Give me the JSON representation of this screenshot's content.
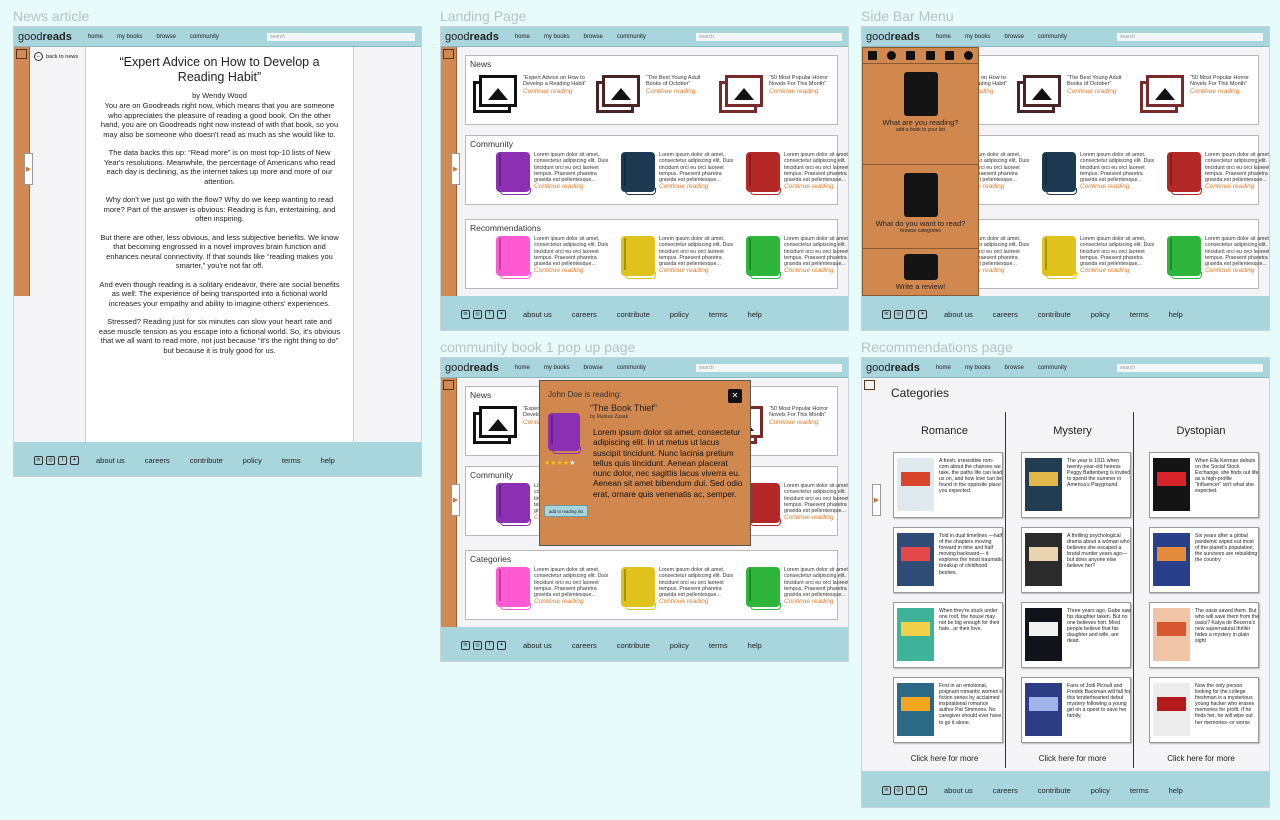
{
  "labels": {
    "news_article": "News article",
    "landing": "Landing Page",
    "sidebar_menu": "Side Bar Menu",
    "popup": "community book 1 pop up page",
    "recommendations": "Recommendations page"
  },
  "nav": {
    "logo_plain": "good",
    "logo_bold": "reads",
    "links": [
      "home",
      "my books",
      "browse",
      "community"
    ],
    "search_placeholder": "search"
  },
  "footer": {
    "icons": [
      "in",
      "ig",
      "f",
      "tw"
    ],
    "links": [
      "about us",
      "careers",
      "contribute",
      "policy",
      "terms",
      "help"
    ]
  },
  "article": {
    "back": "back to news",
    "title": "“Expert Advice on How to Develop a Reading Habit”",
    "byline": "by Wendy Wood",
    "paragraphs": [
      "You are on Goodreads right now, which means that you are someone who appreciates the pleasure of reading a good book. On the other hand, you are on Goodreads right now instead of with that book, so you may also be someone who doesn't read as much as she would like to.",
      "The data backs this up: “Read more” is on most top-10 lists of New Year's resolutions. Meanwhile, the percentage of Americans who read each day is declining, as the internet takes up more and more of our attention.",
      "Why don't we just go with the flow? Why do we keep wanting to read more? Part of the answer is obvious: Reading is fun, entertaining, and often inspiring.",
      "But there are other, less obvious, and less subjective benefits. We know that becoming engrossed in a novel improves brain function and enhances neural connectivity. If that sounds like “reading makes you smarter,” you're not far off.",
      "And even though reading is a solitary endeavor, there are social benefits as well: The experience of being transported into a fictional world increases your empathy and ability to imagine others' experiences.",
      "Stressed? Reading just for six minutes can slow your heart rate and ease muscle tension as you escape into a fictional world. So, it's obvious that we all want to read more, not just because “it's the right thing to do” but because it is truly good for us."
    ]
  },
  "landing": {
    "news_title": "News",
    "community_title": "Community",
    "recs_title": "Recommendations",
    "categories_title": "Categories",
    "news": [
      {
        "text": "“Expert Advice on How to Develop a Reading Habit”",
        "color": "#111111"
      },
      {
        "text": "“The Best Young Adult Books of October”",
        "color": "#4a2424"
      },
      {
        "text": "“50 Most Popular Horror Novels For This Month”",
        "color": "#7a2a2a"
      }
    ],
    "lorem": "Lorem ipsum dolor sit amet, consectetur adipiscing elit. Duis tincidunt orci eu orci laoreet tempus. Praesent pharetra gravida est pellentesque...",
    "continue": "Continue reading",
    "community_colors": [
      "#8b2fb3",
      "#1e3a52",
      "#b52828"
    ],
    "rec_colors": [
      "#ff5ad2",
      "#e0c21c",
      "#2db53c"
    ]
  },
  "sidebar": {
    "reading_title": "What are you reading?",
    "reading_sub": "add a book to your list",
    "browse_title": "What do you want to read?",
    "browse_sub": "browse categories",
    "review_title": "Write a review!"
  },
  "popup": {
    "heading": "John Doe is reading:",
    "book_title": "“The Book Thief”",
    "author": "by Markus Zusak",
    "body": "Lorem ipsum dolor sit amet, consectetur adipiscing elit. In ut metus ut lacus suscipit tincidunt. Nunc lacinia pretium tellus quis tincidunt. Aenean placerat nunc dolor, nec sagittis lacus viverra eu. Aenean sit amet bibendum dui. Sed odio erat, ornare quis venenatis ac, semper.",
    "add_button": "add to reading list",
    "close": "✕",
    "rating": 4
  },
  "recs_page": {
    "title": "Categories",
    "more": "Click here for more",
    "columns": [
      {
        "name": "Romance",
        "books": [
          {
            "cover": "#dfe9ee",
            "accent": "#d7452c",
            "text": "A fresh, irresistible rom-com about the chances we take, the paths life can lead us on, and how love can be found in the opposite place you expected."
          },
          {
            "cover": "#2f4c77",
            "accent": "#e44848",
            "text": "Told in dual timelines —half of the chapters moving forward in time and half moving backward— it explores the most traumatic breakup of childhood besties."
          },
          {
            "cover": "#3fb39a",
            "accent": "#f1d04a",
            "text": "When they're stuck under one roof, the house may not be big enough for their hate...or their love."
          },
          {
            "cover": "#2a6a84",
            "accent": "#f2a51f",
            "text": "First in an emotional, poignant romantic women's fiction series by acclaimed inspirational romance author Pat Simmons. No caregiver should ever have to go it alone."
          }
        ]
      },
      {
        "name": "Mystery",
        "books": [
          {
            "cover": "#223c52",
            "accent": "#e3b84b",
            "text": "The year is 1911 when twenty-year-old heiress Peggy Battenberg is invited to spend the summer in America's Playground."
          },
          {
            "cover": "#2b2b2b",
            "accent": "#ead3b0",
            "text": "A thrilling psychological drama about a woman who believes she escaped a brutal murder years ago—but does anyone else believe her?"
          },
          {
            "cover": "#12131a",
            "accent": "#f2f2f2",
            "text": "Three years ago, Gabe saw his daughter taken. But no one believes him. Most people believe that his daughter and wife, are dead."
          },
          {
            "cover": "#2c3d86",
            "accent": "#9fb3e6",
            "text": "Fans of Jodi Picoult and Fredrik Backman will fall for this tenderhearted debut mystery following a young girl on a quest to save her family."
          }
        ]
      },
      {
        "name": "Dystopian",
        "books": [
          {
            "cover": "#141414",
            "accent": "#d8232a",
            "text": "When Ella Kerman debuts on the Social Stock Exchange, she finds out life as a high-profile “Influencer” isn't what she expected."
          },
          {
            "cover": "#2a3f8a",
            "accent": "#e58c3c",
            "text": "Six years after a global pandemic wiped out most of the planet's population, the survivors are rebuilding the country"
          },
          {
            "cover": "#f0c5a5",
            "accent": "#d8562f",
            "text": "The oasis saved them. But who will save them from the oasis? Katya de Becerra's new supernatural thriller hides a mystery in plain sight"
          },
          {
            "cover": "#ececec",
            "accent": "#b61b1b",
            "text": "Now the only person looking for the college freshman is a mysterious young hacker who erases memories for profit. If he finds her, he will wipe out her memories--or worse"
          }
        ]
      }
    ]
  }
}
